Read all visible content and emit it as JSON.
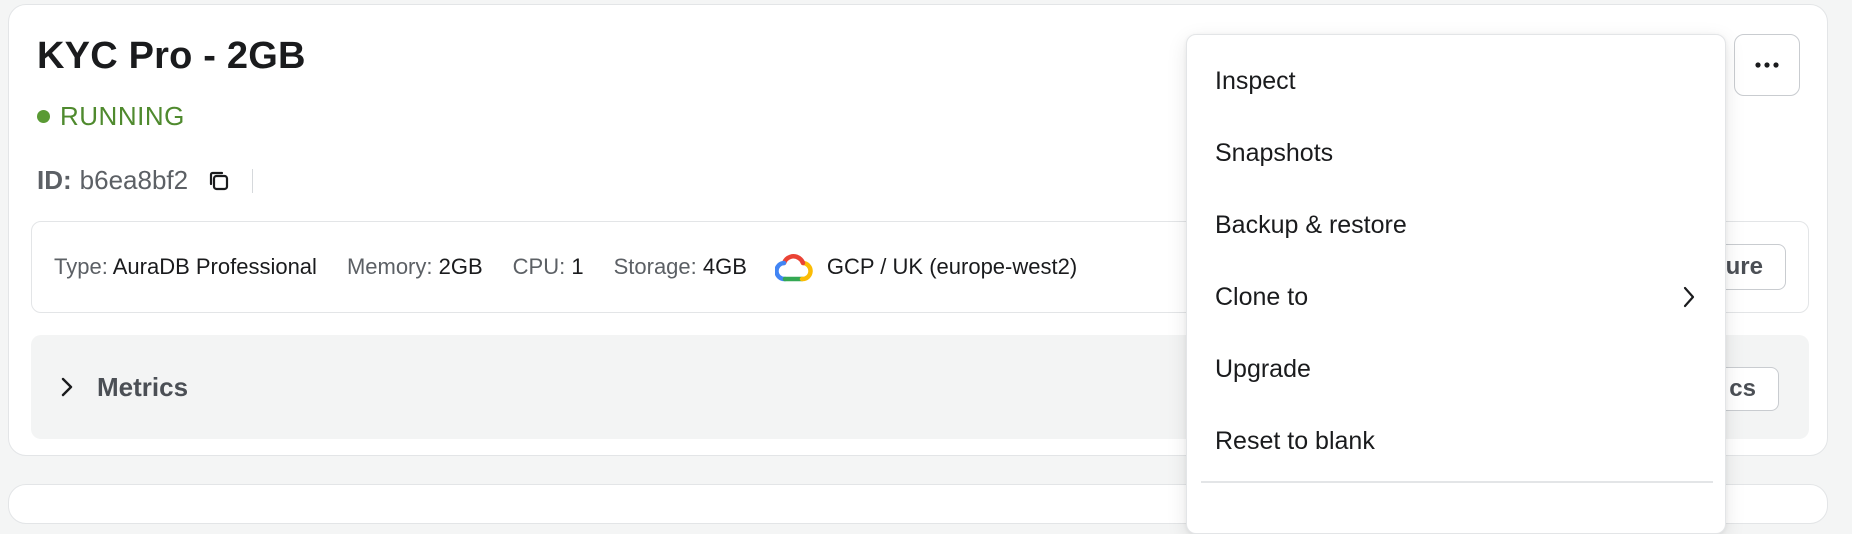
{
  "instance": {
    "title": "KYC Pro - 2GB",
    "status": "RUNNING",
    "id_label": "ID:",
    "id_value": "b6ea8bf2"
  },
  "info": {
    "type_label": "Type:",
    "type_value": "AuraDB Professional",
    "memory_label": "Memory:",
    "memory_value": "2GB",
    "cpu_label": "CPU:",
    "cpu_value": "1",
    "storage_label": "Storage:",
    "storage_value": "4GB",
    "region": "GCP / UK (europe-west2)",
    "configure_button_visible": "ure"
  },
  "metrics": {
    "label": "Metrics",
    "button_visible": "cs"
  },
  "menu": {
    "items": [
      {
        "label": "Inspect"
      },
      {
        "label": "Snapshots"
      },
      {
        "label": "Backup & restore"
      },
      {
        "label": "Clone to",
        "has_submenu": true
      },
      {
        "label": "Upgrade"
      },
      {
        "label": "Reset to blank"
      }
    ]
  },
  "colors": {
    "status_running": "#4f8a2e",
    "text_primary": "#1a1b1d",
    "text_secondary": "#5c6065",
    "border": "#e3e5e7"
  },
  "icons": [
    "copy-icon",
    "gcp-logo-icon",
    "chevron-right-icon",
    "more-horizontal-icon"
  ]
}
